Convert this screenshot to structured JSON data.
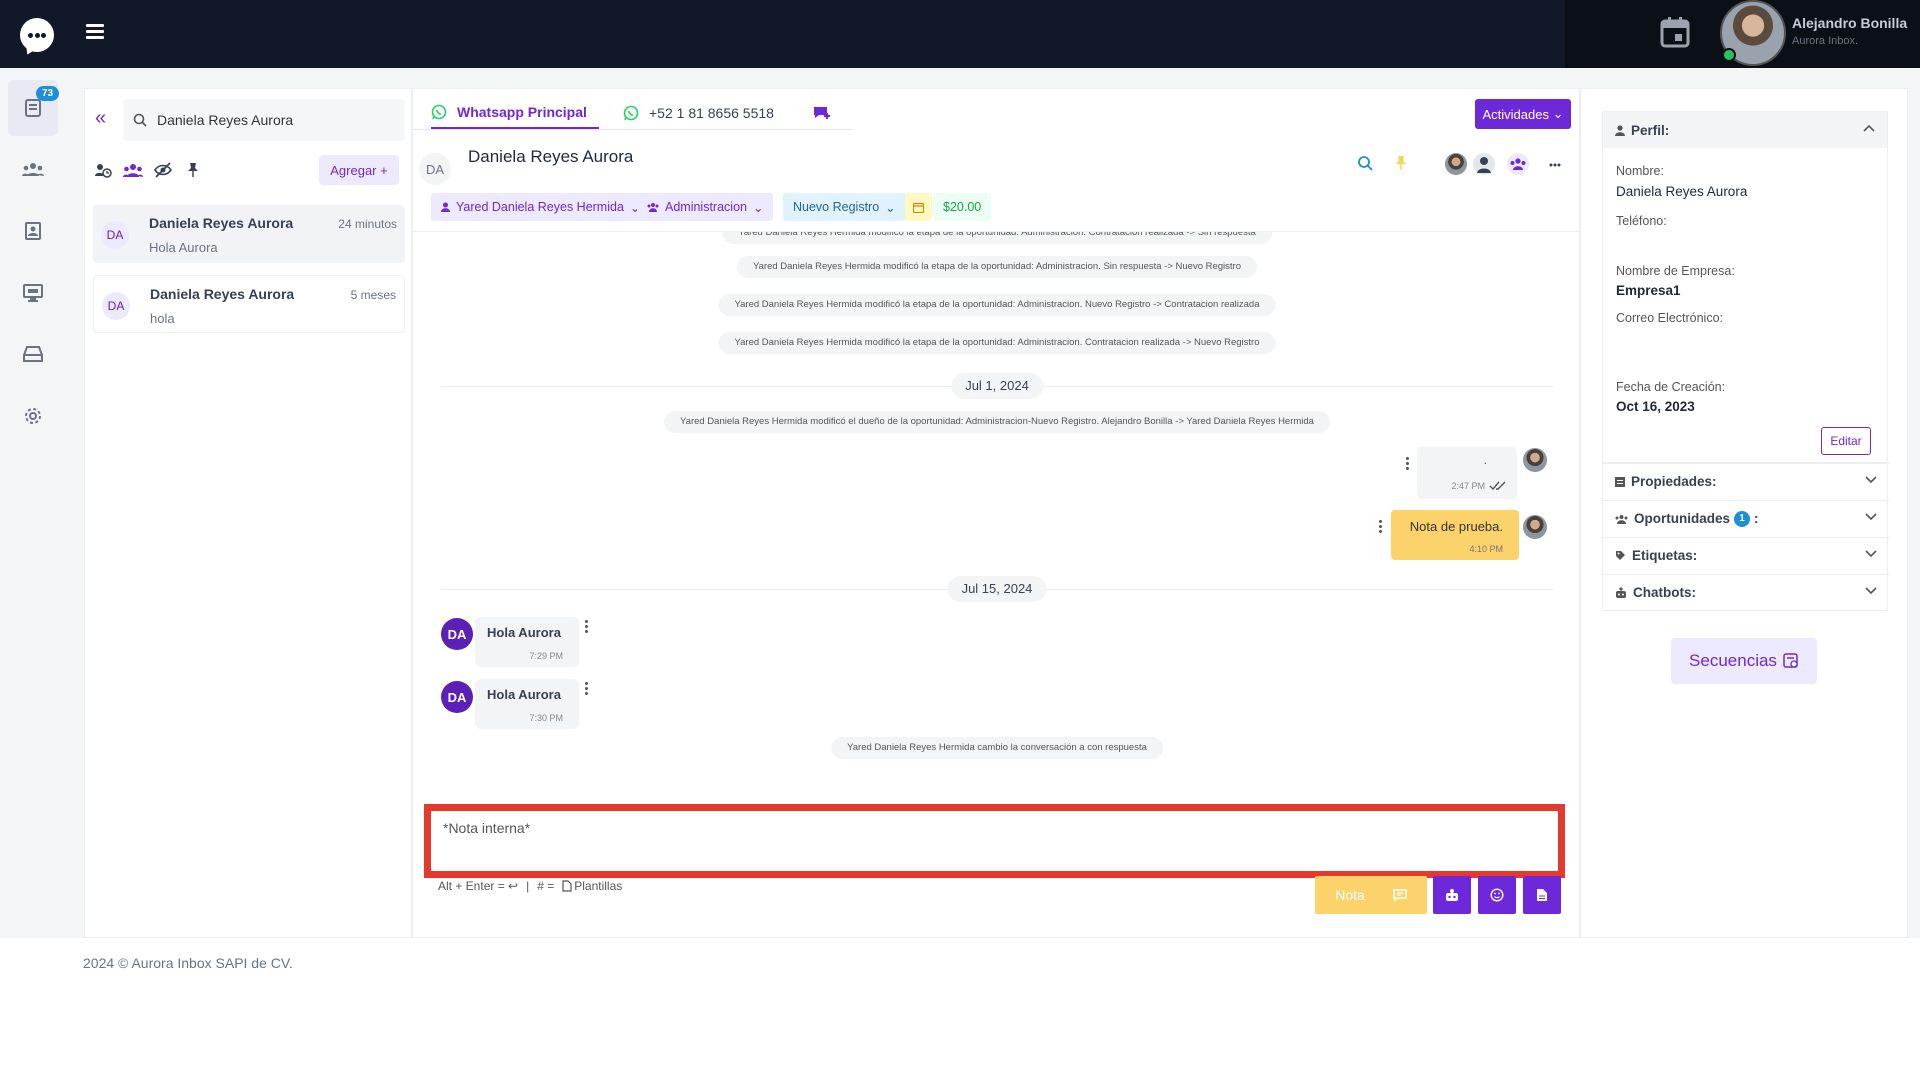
{
  "topbar": {
    "user_name": "Alejandro Bonilla",
    "user_org": "Aurora Inbox."
  },
  "sidebar": {
    "badge": "73"
  },
  "search": {
    "value": "Daniela Reyes Aurora"
  },
  "list": {
    "add_label": "Agregar +",
    "conversations": [
      {
        "initials": "DA",
        "name": "Daniela Reyes Aurora",
        "time": "24 minutos",
        "preview": "Hola Aurora"
      },
      {
        "initials": "DA",
        "name": "Daniela Reyes Aurora",
        "time": "5 meses",
        "preview": "hola"
      }
    ]
  },
  "chat": {
    "tabs": {
      "main": "Whatsapp Principal",
      "phone": "+52 1 81 8656 5518"
    },
    "actividades_label": "Actividades",
    "contact_initials": "DA",
    "contact_name": "Daniela Reyes Aurora",
    "pills": {
      "agent": "Yared Daniela Reyes Hermida",
      "team": "Administracion",
      "stage": "Nuevo Registro",
      "amount": "$20.00"
    },
    "system_messages": [
      "Yared Daniela Reyes Hermida modificó la etapa de la oportunidad: Administracion. Contratacion realizada -> Sin respuesta",
      "Yared Daniela Reyes Hermida modificó la etapa de la oportunidad: Administracion. Sin respuesta -> Nuevo Registro",
      "Yared Daniela Reyes Hermida modificó la etapa de la oportunidad: Administracion. Nuevo Registro -> Contratacion realizada",
      "Yared Daniela Reyes Hermida modificó la etapa de la oportunidad: Administracion. Contratacion realizada -> Nuevo Registro",
      "Yared Daniela Reyes Hermida modificó el dueño de la oportunidad: Administracion-Nuevo Registro. Alejandro Bonilla -> Yared Daniela Reyes Hermida",
      "Yared Daniela Reyes Hermida cambio la conversación a con respuesta"
    ],
    "dates": [
      "Jul 1, 2024",
      "Jul 15, 2024"
    ],
    "outgoing": [
      {
        "text": ".",
        "time": "2:47 PM"
      },
      {
        "text": "Nota de prueba.",
        "time": "4:10 PM"
      }
    ],
    "incoming": [
      {
        "initials": "DA",
        "text": "Hola Aurora",
        "time": "7:29 PM"
      },
      {
        "initials": "DA",
        "text": "Hola Aurora",
        "time": "7:30 PM"
      }
    ]
  },
  "composer": {
    "value": "*Nota interna*",
    "hint_shortcut": "Alt + Enter = ↩",
    "hint_sep": "|",
    "hint_templates_prefix": "# =",
    "hint_templates": "Plantillas",
    "note_button": "Nota"
  },
  "profile": {
    "perfil_label": "Perfil:",
    "nombre_label": "Nombre:",
    "nombre": "Daniela Reyes Aurora",
    "telefono_label": "Teléfono:",
    "empresa_label": "Nombre de Empresa:",
    "empresa": "Empresa1",
    "correo_label": "Correo Electrónico:",
    "fecha_label": "Fecha de Creación:",
    "fecha": "Oct 16, 2023",
    "editar_label": "Editar",
    "propiedades_label": "Propiedades:",
    "oportunidades_label": "Oportunidades",
    "oportunidades_count": "1",
    "oportunidades_suffix": ":",
    "etiquetas_label": "Etiquetas:",
    "chatbots_label": "Chatbots:",
    "secuencias_label": "Secuencias"
  },
  "footer": {
    "text": "2024 © Aurora Inbox SAPI de CV."
  },
  "colors": {
    "accent": "#6d28d9",
    "topbar": "#111827",
    "note": "#fcd36a",
    "whatsapp": "#25d366",
    "highlight": "#e5392e"
  }
}
